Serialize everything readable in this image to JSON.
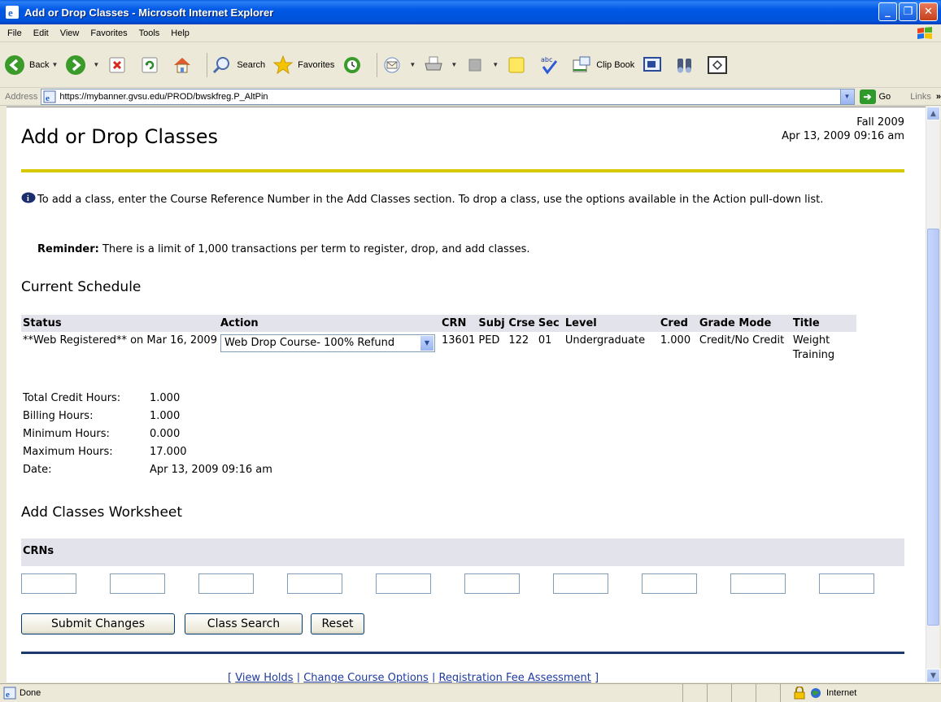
{
  "window": {
    "title": "Add or Drop Classes - Microsoft Internet Explorer"
  },
  "menu": {
    "items": [
      "File",
      "Edit",
      "View",
      "Favorites",
      "Tools",
      "Help"
    ]
  },
  "toolbar": {
    "back_label": "Back",
    "search_label": "Search",
    "favorites_label": "Favorites",
    "clipbook_label": "Clip Book"
  },
  "address": {
    "label": "Address",
    "url": "https://mybanner.gvsu.edu/PROD/bwskfreg.P_AltPin",
    "go_label": "Go",
    "links_label": "Links"
  },
  "page": {
    "title": "Add or Drop Classes",
    "term": "Fall 2009",
    "datetime": "Apr 13, 2009 09:16 am",
    "info": "To add a class, enter the Course Reference Number in the Add Classes section. To drop a class, use the options available in the Action pull-down list.",
    "reminder_label": "Reminder:",
    "reminder_text": " There is a limit of 1,000 transactions per term to register, drop, and add classes."
  },
  "schedule": {
    "heading": "Current Schedule",
    "columns": [
      "Status",
      "Action",
      "CRN",
      "Subj",
      "Crse",
      "Sec",
      "Level",
      "Cred",
      "Grade Mode",
      "Title"
    ],
    "row": {
      "status": "**Web Registered** on Mar 16, 2009",
      "action": "Web Drop Course- 100% Refund",
      "crn": "13601",
      "subj": "PED",
      "crse": "122",
      "sec": "01",
      "level": "Undergraduate",
      "cred": "1.000",
      "grade_mode": "Credit/No Credit",
      "title": "Weight Training"
    }
  },
  "totals": {
    "total_credit_label": "Total Credit Hours:",
    "total_credit": "1.000",
    "billing_label": "Billing Hours:",
    "billing": "1.000",
    "min_label": "Minimum Hours:",
    "min": "0.000",
    "max_label": "Maximum Hours:",
    "max": "17.000",
    "date_label": "Date:",
    "date": "Apr 13, 2009 09:16 am"
  },
  "worksheet": {
    "heading": "Add Classes Worksheet",
    "crn_label": "CRNs"
  },
  "buttons": {
    "submit": "Submit Changes",
    "class_search": "Class Search",
    "reset": "Reset"
  },
  "footer": {
    "open": "[ ",
    "sep": " | ",
    "close": " ]",
    "view_holds": "View Holds",
    "change_options": "Change Course Options",
    "fee_assessment": "Registration Fee Assessment"
  },
  "status": {
    "text": "Done",
    "zone": "Internet"
  },
  "colors": {
    "accent_rule": "#d8c800",
    "navy_rule": "#1c3a6e",
    "header_bg": "#e3e3ec"
  }
}
